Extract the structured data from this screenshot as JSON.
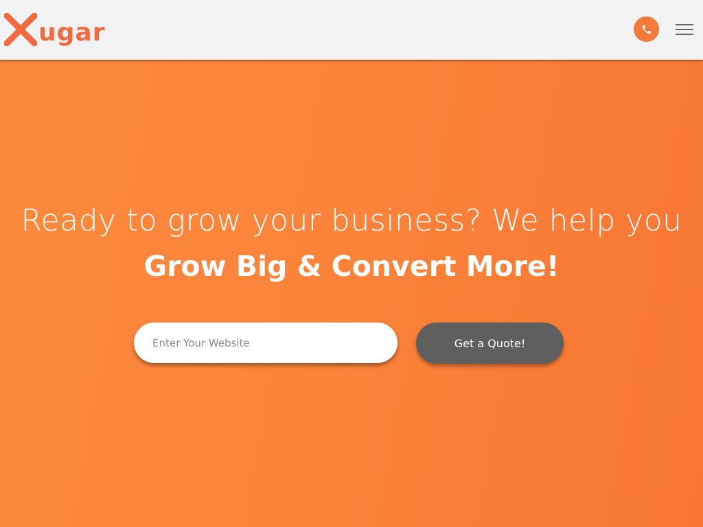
{
  "brand": {
    "logo_text": "ugar",
    "logo_mark": "X",
    "accent_color": "#f47a3c",
    "logo_color": "#f26a3f"
  },
  "header": {
    "phone_icon": "phone-icon",
    "menu_icon": "hamburger-menu-icon"
  },
  "hero": {
    "headline_line1": "Ready to grow your business? We help you",
    "headline_line2": "Grow Big & Convert More!",
    "background_color": "#fb843a",
    "website_input": {
      "value": "",
      "placeholder": "Enter Your Website"
    },
    "quote_button_label": "Get a Quote!",
    "quote_button_color": "#5f5f5f"
  }
}
